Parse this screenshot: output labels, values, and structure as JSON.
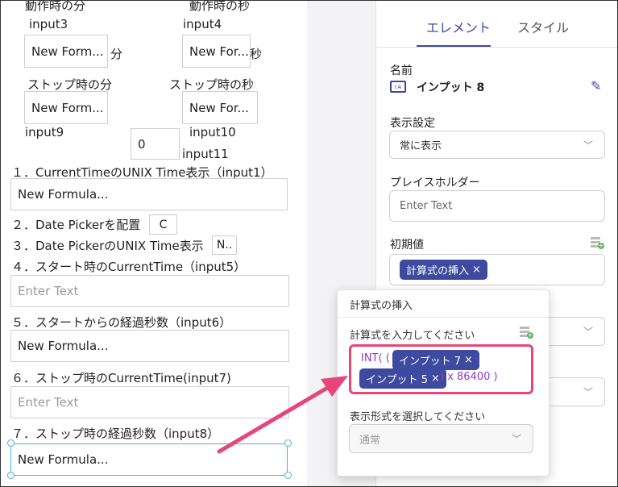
{
  "canvas": {
    "top_left_label": "動作時の分",
    "top_right_label": "動作時の秒",
    "input3": "input3",
    "input4": "input4",
    "field_min_run": "New Form...",
    "field_sec_run": "New For...",
    "unit_min": "分",
    "unit_sec": "秒",
    "stop_min_label": "ストップ時の分",
    "stop_sec_label": "ストップ時の秒",
    "field_min_stop": "New Form...",
    "field_sec_stop": "New For...",
    "input9": "input9",
    "zero_value": "0",
    "input10": "input10",
    "input11": "input11",
    "step1": "１．CurrentTimeのUNIX Time表示（input1）",
    "step1_field": "New Formula...",
    "step2": "２．Date Pickerを配置",
    "step2_box": "C",
    "step3": "３．Date PickerのUNIX Time表示",
    "step3_box": "N..",
    "step4": "４．スタート時のCurrentTime（input5）",
    "step4_field": "Enter Text",
    "step5": "５．スタートからの経過秒数（input6）",
    "step5_field": "New Formula...",
    "step6": "６．ストップ時のCurrentTime(input7)",
    "step6_field": "Enter Text",
    "step7": "７．ストップ時の経過秒数（input8）",
    "step7_field": "New Formula..."
  },
  "panel": {
    "tabs": [
      "エレメント",
      "スタイル"
    ],
    "name_label": "名前",
    "name_value": "インプット 8",
    "display_label": "表示設定",
    "display_value": "常に表示",
    "placeholder_label": "プレイスホルダー",
    "placeholder_value": "Enter Text",
    "initial_label": "初期値",
    "initial_chip": "計算式の挿入",
    "initial_chip_close": "×"
  },
  "popup": {
    "title": "計算式の挿入",
    "formula_label": "計算式を入力してください",
    "formula_open": "INT( (",
    "chip1": "インプット 7",
    "minus": "-",
    "chip2": "インプット 5",
    "formula_close": ") x 86400 )",
    "chip_close": "×",
    "format_label": "表示形式を選択してください",
    "format_value": "通常"
  },
  "colors": {
    "accent": "#3d4aa0",
    "highlight": "#e8457a",
    "formula_text": "#8a3ccf"
  }
}
